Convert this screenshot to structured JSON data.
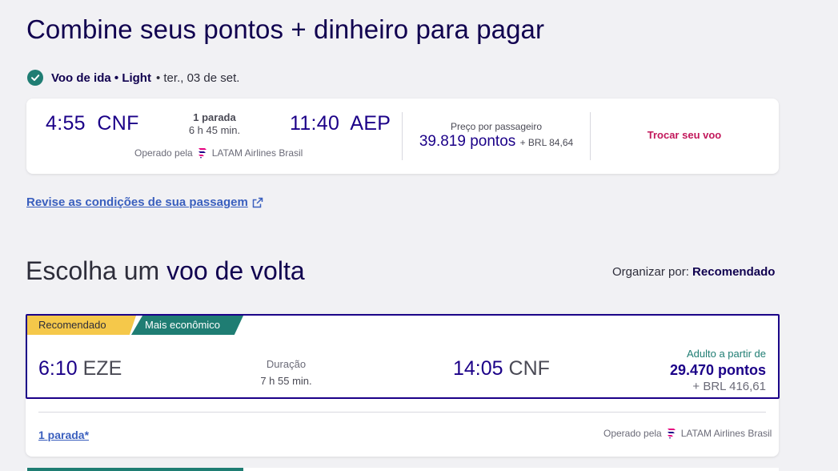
{
  "page": {
    "title": "Combine seus pontos + dinheiro para pagar"
  },
  "outbound": {
    "header_bold": "Voo de ida • Light",
    "header_date": "• ter., 03 de set.",
    "dep_time": "4:55",
    "dep_city": "CNF",
    "stops": "1 parada",
    "duration": "6 h 45 min.",
    "arr_time": "11:40",
    "arr_city": "AEP",
    "operated_label": "Operado pela",
    "airline": "LATAM Airlines Brasil",
    "price_label": "Preço por passageiro",
    "price_points": "39.819 pontos",
    "price_cash": "+ BRL 84,64",
    "change_label": "Trocar seu voo"
  },
  "review_link": "Revise as condições de sua passagem",
  "return_section": {
    "title_light": "Escolha um",
    "title_bold": "voo de volta",
    "sort_label": "Organizar por:",
    "sort_value": "Recomendado"
  },
  "return_flight": {
    "badge_recommended": "Recomendado",
    "badge_economic": "Mais econômico",
    "dep_time": "6:10",
    "dep_city": "EZE",
    "duration_label": "Duração",
    "duration": "7 h 55 min.",
    "arr_time": "14:05",
    "arr_city": "CNF",
    "price_label": "Adulto a partir de",
    "price_points": "29.470 pontos",
    "price_cash": "+ BRL 416,61",
    "stops_link": "1 parada*",
    "operated_label": "Operado pela",
    "airline": "LATAM Airlines Brasil"
  },
  "colors": {
    "brand_navy": "#1b0088",
    "accent_teal": "#1f7d73",
    "badge_yellow": "#f5c84a",
    "link_blue": "#3a5fbe",
    "change_magenta": "#c2185b"
  }
}
